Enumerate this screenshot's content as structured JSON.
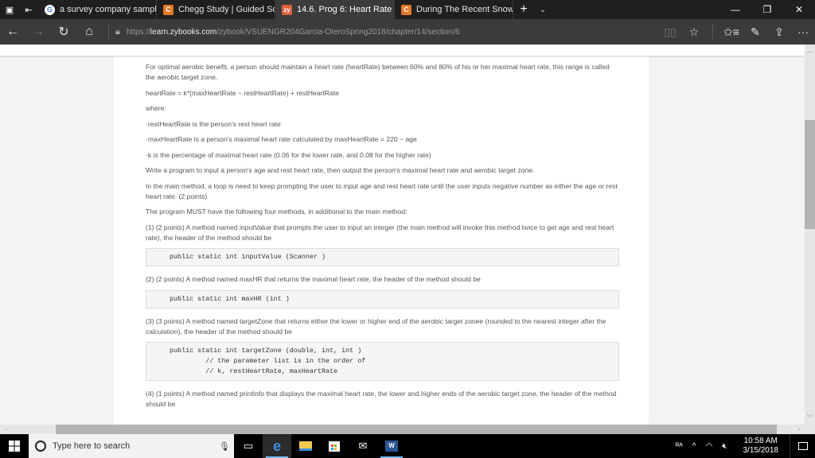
{
  "browser": {
    "tabs": [
      {
        "favicon": "google-icon",
        "favicon_text": "G",
        "title": "a survey company sampled",
        "active": false
      },
      {
        "favicon": "chegg-icon",
        "favicon_text": "C",
        "title": "Chegg Study | Guided Solut",
        "active": false
      },
      {
        "favicon": "zybooks-icon",
        "favicon_text": "zy",
        "title": "14.6. Prog 6: Heart Rate",
        "active": true
      },
      {
        "favicon": "chegg-icon",
        "favicon_text": "C",
        "title": "During The Recent Snowing",
        "active": false
      }
    ],
    "url_prefix": "https://",
    "url_domain": "learn.zybooks.com",
    "url_path": "/zybook/VSUENGR204Garcia-OteroSpring2018/chapter/14/section/6",
    "window_controls": {
      "minimize": "—",
      "restore": "❐",
      "close": "✕"
    }
  },
  "content": {
    "intro": "For optimal aerobic benefit, a person should maintain a heart rate (heartRate) between 60% and 80% of his or her maximal heart rate, this range is called the aerobic target zone.",
    "formula": "heartRate = k*(maxHeartRate − restHeartRate) + restHeartRate",
    "where": "where:",
    "bullets": [
      "restHeartRate is the person's rest heart rate",
      "maxHeartRate is a person's maximal heart rate calculated by maxHeartRate = 220 − age",
      "k is the percentage of maximal heart rate (0.06 for the lower rate, and 0.08 for the higher rate)"
    ],
    "task": "Write a program to input a person's age and rest heart rate, then output the person's maximal heart rate and aerobic target zone.",
    "loop": "In the main method, a loop is need to keep prompting the user to input age and rest heart rate until the user inputs negative number as either the age or rest heart rate. (2 points)",
    "must": "The program MUST have the following four methods, in additional to the main method:",
    "method1": "(1) (2 points) A method named inputValue that prompts the user to input an integer (the main method will invoke this method twice to get age and rest heart rate), the header of the method should be",
    "code1": "public static int inputValue (Scanner )",
    "method2": "(2) (2 points) A method named maxHR that returns the maximal heart rate, the header of the method should be",
    "code2": "public static int maxHR (int )",
    "method3": "(3) (3 points) A method named targetZone that returns either the lower or higher end of the aerobic target zonee (rounded to the nearest integer after the calculation), the header of the method should be",
    "code3": "public static int targetZone (double, int, int )\n         // the parameter list is in the order of\n         // k, restHeartRate, maxHeartRate",
    "method4": "(4) (1 points) A method named printInfo that displays the maximal heart rate, the lower and higher ends of the aerobic target zone, the header of the method should be"
  },
  "taskbar": {
    "search_placeholder": "Type here to search",
    "time": "10:58 AM",
    "date": "3/15/2018"
  }
}
